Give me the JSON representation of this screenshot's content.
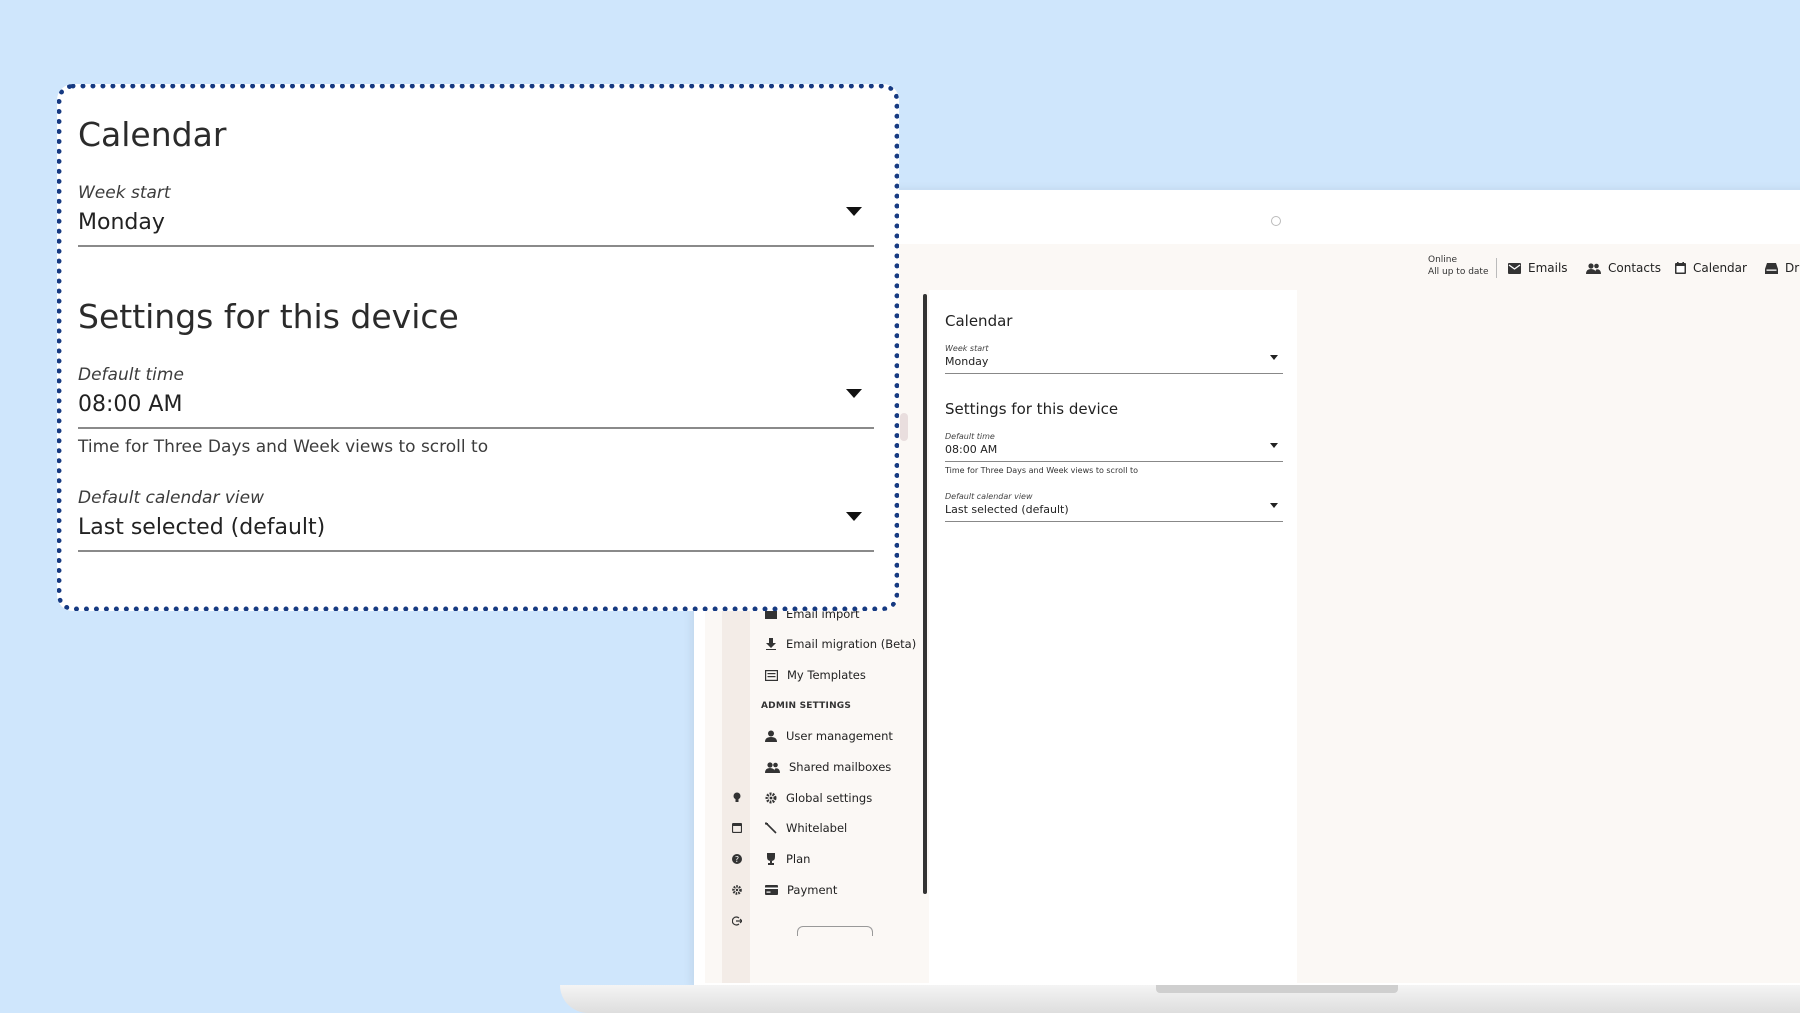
{
  "callout": {
    "calendar_heading": "Calendar",
    "week_start_label": "Week start",
    "week_start_value": "Monday",
    "device_heading": "Settings for this device",
    "default_time_label": "Default time",
    "default_time_value": "08:00 AM",
    "default_time_help": "Time for Three Days and Week views to scroll to",
    "default_view_label": "Default calendar view",
    "default_view_value": "Last selected (default)"
  },
  "status": {
    "line1": "Online",
    "line2": "All up to date"
  },
  "nav": {
    "emails": "Emails",
    "contacts": "Contacts",
    "calendar": "Calendar",
    "drive": "Dr"
  },
  "sidebar": {
    "email_import": "Email import",
    "email_migration": "Email migration (Beta)",
    "my_templates": "My Templates",
    "admin_heading": "ADMIN SETTINGS",
    "user_management": "User management",
    "shared_mailboxes": "Shared mailboxes",
    "global_settings": "Global settings",
    "whitelabel": "Whitelabel",
    "plan": "Plan",
    "payment": "Payment"
  },
  "panel": {
    "calendar_heading": "Calendar",
    "week_start_label": "Week start",
    "week_start_value": "Monday",
    "device_heading": "Settings for this device",
    "default_time_label": "Default time",
    "default_time_value": "08:00 AM",
    "default_time_help": "Time for Three Days and Week views to scroll to",
    "default_view_label": "Default calendar view",
    "default_view_value": "Last selected (default)"
  },
  "colors": {
    "background": "#cfe6fc",
    "callout_border": "#163a82",
    "sidebar_bg": "#fbf8f5"
  }
}
